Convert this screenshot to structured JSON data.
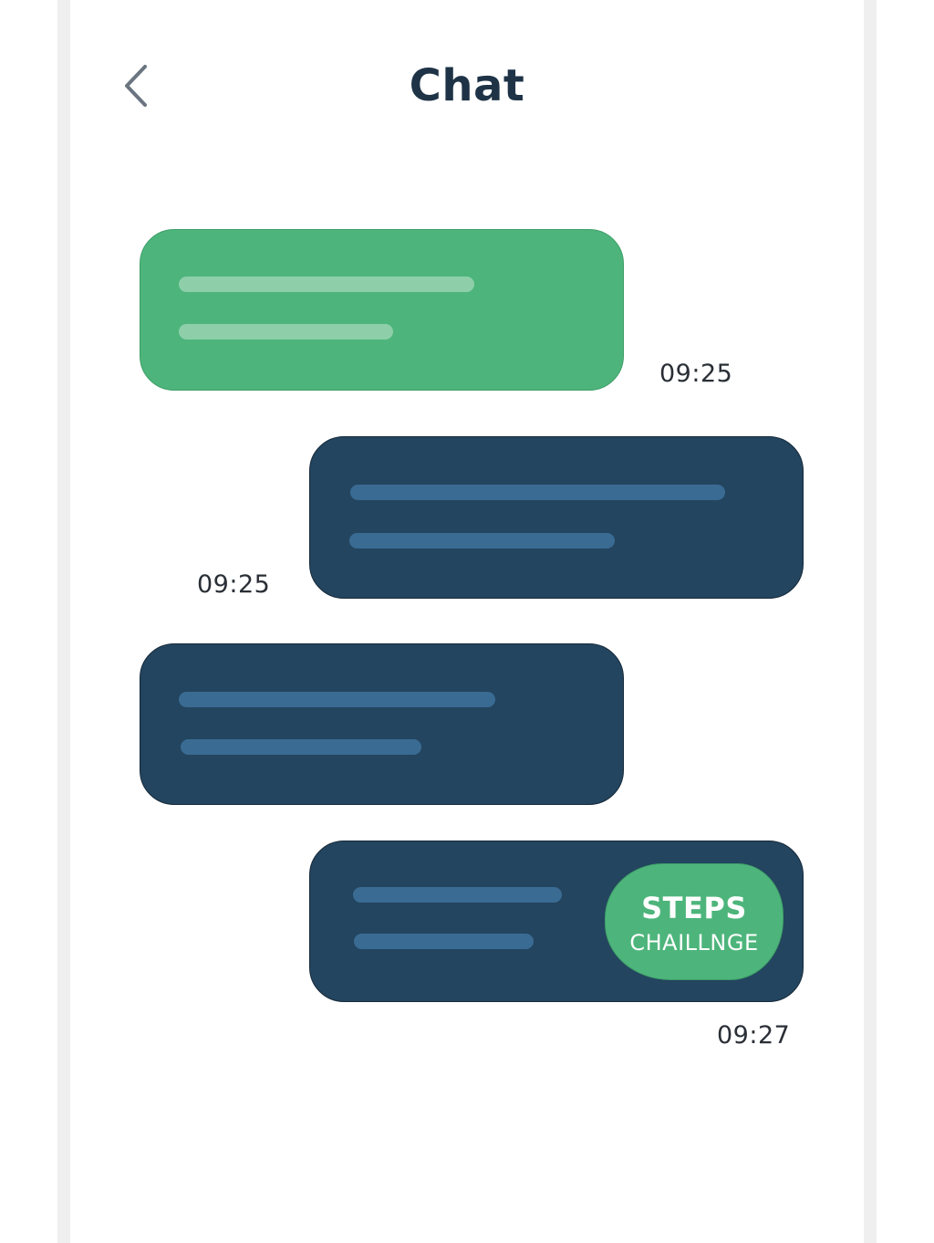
{
  "header": {
    "title": "Chat",
    "back_icon": "chevron-left-icon"
  },
  "messages": [
    {
      "side": "incoming",
      "color": "#4db57b",
      "timestamp": "09:25"
    },
    {
      "side": "outgoing",
      "color": "#23455f",
      "timestamp": "09:25"
    },
    {
      "side": "incoming",
      "color": "#23455f"
    },
    {
      "side": "outgoing",
      "color": "#23455f",
      "timestamp": "09:27",
      "badge": {
        "title": "STEPS",
        "subtitle": "CHAILLNGE",
        "color": "#4db57b"
      }
    }
  ],
  "colors": {
    "accent_green": "#4db57b",
    "bubble_navy": "#23455f",
    "title_text": "#1f3347",
    "placeholder_line_green": "#8ecfaa",
    "placeholder_line_navy": "#3a6b93"
  }
}
